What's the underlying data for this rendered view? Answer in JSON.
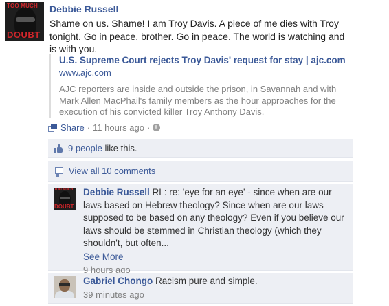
{
  "post": {
    "author": "Debbie Russell",
    "avatar_brand_top": "TOO MUCH",
    "avatar_brand_bottom": "DOUBT",
    "message": "Shame on us. Shame! I am Troy Davis. A piece of me dies with Troy tonight. Go in peace, brother. Go in peace. The world is watching and is with you.",
    "attachment": {
      "title": "U.S. Supreme Court rejects Troy Davis' request for stay | ajc.com",
      "url": "www.ajc.com",
      "description": "AJC reporters are inside and outside the prison, in Savannah and with Mark Allen MacPhail's family members as the hour approaches for the execution of his convicted killer Troy Anthony Davis."
    },
    "actions": {
      "share_label": "Share",
      "separator": "·",
      "timestamp": "11 hours ago"
    }
  },
  "ufi": {
    "likes_link": "9 people",
    "likes_suffix": "like this.",
    "view_all": "View all 10 comments"
  },
  "comments": [
    {
      "author": "Debbie Russell",
      "text": "RL: re: 'eye for an eye' - since when are our laws based on Hebrew theology? Since when are our laws supposed to be based on any theology? Even if you believe our laws should be stemmed in Christian theology (which they shouldn't, but often...",
      "see_more": "See More",
      "time": "9 hours ago"
    },
    {
      "author": "Gabriel Chongo",
      "text": "Racism pure and simple.",
      "time": "39 minutes ago"
    }
  ],
  "colors": {
    "link": "#3b5998",
    "ufi_background": "#edeff4",
    "meta_text": "#808080",
    "brand_red": "#d0262b"
  },
  "icons": [
    "share-icon",
    "globe-icon",
    "like-icon",
    "comment-icon"
  ]
}
